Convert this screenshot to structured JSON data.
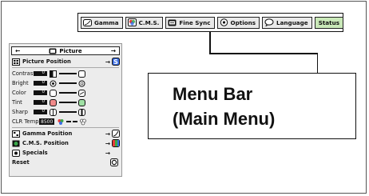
{
  "menubar": {
    "tabs": [
      {
        "id": "gamma",
        "label": "Gamma",
        "icon": "gamma-icon"
      },
      {
        "id": "cms",
        "label": "C.M.S.",
        "icon": "cms-icon"
      },
      {
        "id": "finesync",
        "label": "Fine Sync",
        "icon": "fine-sync-icon"
      },
      {
        "id": "options",
        "label": "Options",
        "icon": "options-icon"
      },
      {
        "id": "language",
        "label": "Language",
        "icon": "language-icon"
      },
      {
        "id": "status",
        "label": "Status",
        "icon": ""
      }
    ],
    "active_tab": "Status",
    "active_color": "#c9e8b8"
  },
  "callout": {
    "line1": "Menu Bar",
    "line2": "(Main Menu)"
  },
  "panel": {
    "title": "Picture",
    "picture_position": "Picture Position",
    "adjustments": [
      {
        "label": "Contrast",
        "value": "0"
      },
      {
        "label": "Bright",
        "value": "0"
      },
      {
        "label": "Color",
        "value": "0"
      },
      {
        "label": "Tint",
        "value": "0"
      },
      {
        "label": "Sharp",
        "value": "0"
      }
    ],
    "clr_temp_label": "CLR Temp",
    "clr_temp_value": "8500",
    "gamma_position": "Gamma Position",
    "cms_position": "C.M.S. Position",
    "specials": "Specials",
    "reset": "Reset"
  }
}
